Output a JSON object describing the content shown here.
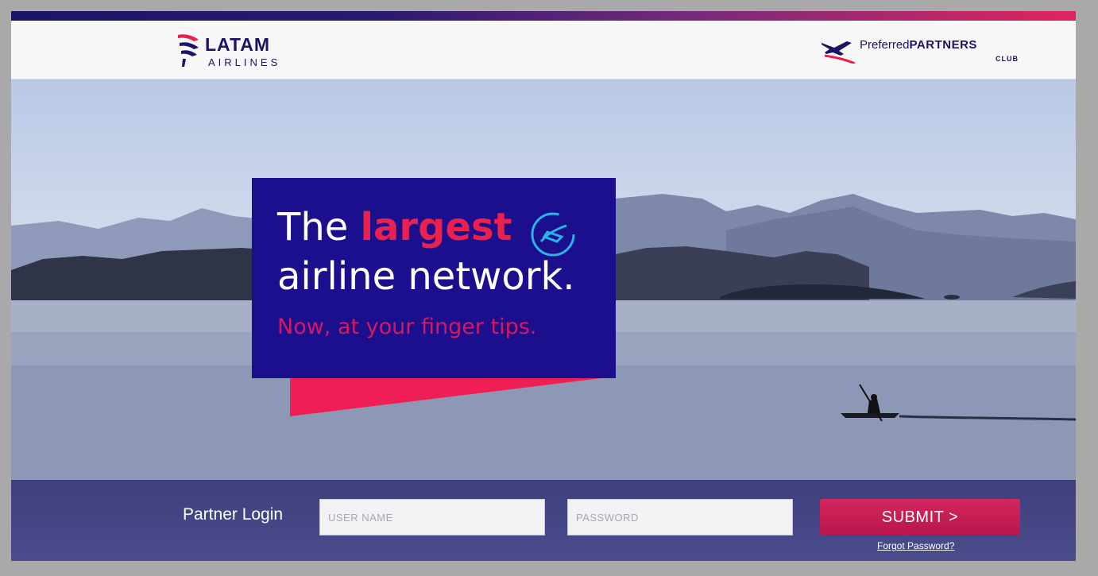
{
  "header": {
    "latam_wordmark": "LATAM",
    "latam_sub": "AIRLINES",
    "partner_logo_prefix": "Preferred",
    "partner_logo_main": "PARTNERS",
    "partner_logo_club": "CLUB"
  },
  "promo": {
    "line1_start": "The",
    "line1_accent": "largest",
    "line2": "airline network.",
    "line3": "Now, at your finger tips.",
    "icon": "globe-plane-icon"
  },
  "login": {
    "label": "Partner Login",
    "username_placeholder": "USER NAME",
    "password_placeholder": "PASSWORD",
    "submit_label": "SUBMIT >",
    "forgot_label": "Forgot Password?"
  },
  "colors": {
    "brand_navy": "#1b0f8e",
    "brand_red": "#e8214f",
    "login_bar": "#45468a"
  }
}
